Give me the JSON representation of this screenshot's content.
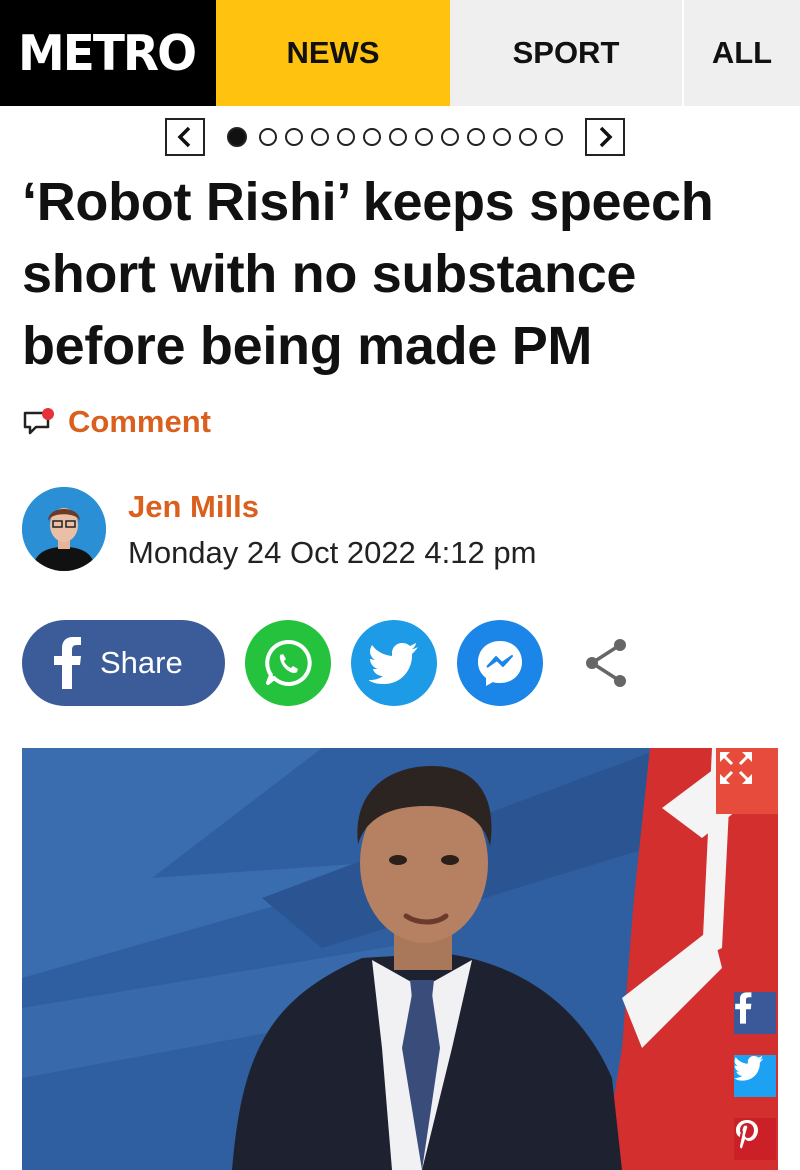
{
  "nav": {
    "logo": "METRO",
    "tabs": [
      {
        "label": "NEWS",
        "active": true
      },
      {
        "label": "SPORT",
        "active": false
      },
      {
        "label": "ALL",
        "active": false
      }
    ]
  },
  "carousel": {
    "total_dots": 13,
    "active_index": 0
  },
  "article": {
    "headline": "‘Robot Rishi’ keeps speech short with no substance before being made PM",
    "comment_label": "Comment",
    "author": "Jen Mills",
    "date": "Monday 24 Oct 2022 4:12 pm"
  },
  "share": {
    "facebook_label": "Share"
  },
  "icons": {
    "comment": "comment-icon",
    "facebook": "facebook-icon",
    "whatsapp": "whatsapp-icon",
    "twitter": "twitter-icon",
    "messenger": "messenger-icon",
    "share": "share-icon",
    "expand": "expand-icon",
    "pinterest": "pinterest-icon"
  },
  "colors": {
    "news_tab": "#ffc20e",
    "accent_orange": "#d9601d",
    "facebook": "#3b5c99",
    "whatsapp": "#25c23e",
    "twitter": "#1d9be6",
    "messenger": "#1b86e8",
    "pinterest": "#cb2027"
  }
}
